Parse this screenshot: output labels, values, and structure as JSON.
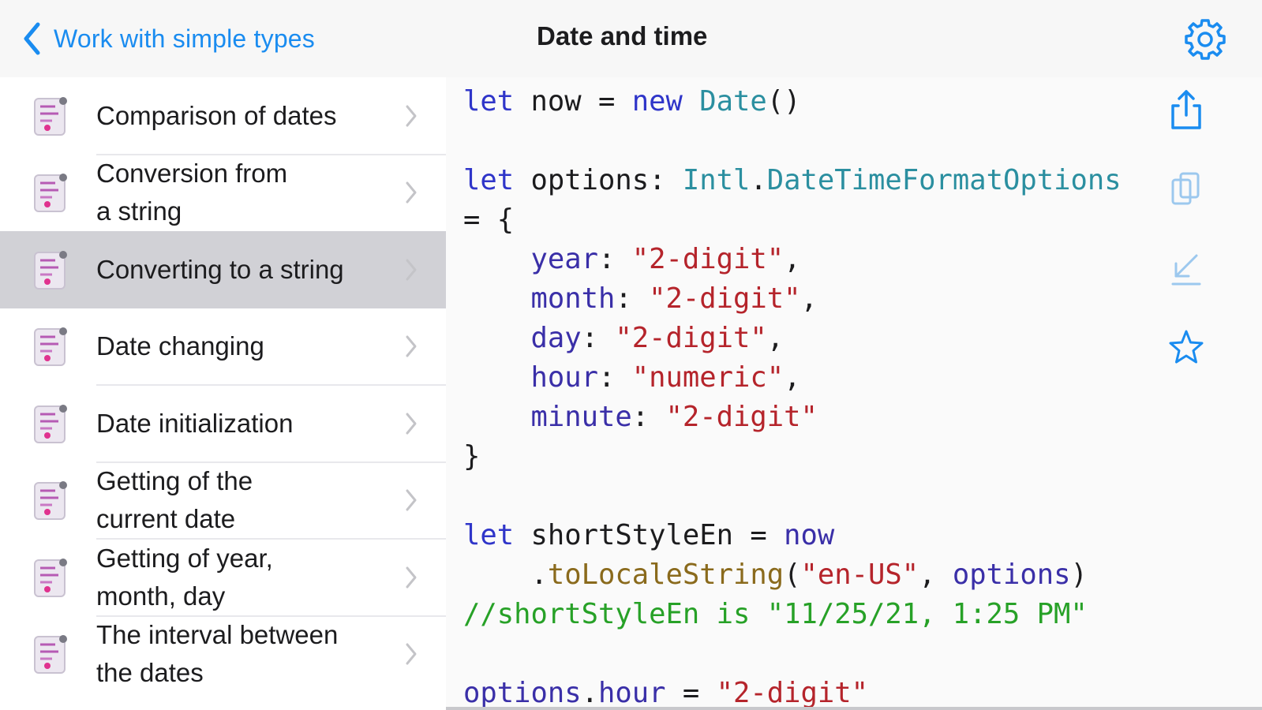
{
  "navbar": {
    "back_label": "Work with simple types",
    "title": "Date and time"
  },
  "sidebar": {
    "items": [
      {
        "label": "Comparison of dates",
        "selected": false
      },
      {
        "label": "Conversion from\na string",
        "selected": false
      },
      {
        "label": "Converting to a string",
        "selected": true
      },
      {
        "label": "Date changing",
        "selected": false
      },
      {
        "label": "Date initialization",
        "selected": false
      },
      {
        "label": "Getting of the\ncurrent date",
        "selected": false
      },
      {
        "label": "Getting of year,\nmonth, day",
        "selected": false
      },
      {
        "label": "The interval between\nthe dates",
        "selected": false
      }
    ]
  },
  "code_lines": [
    "let now = new Date()",
    "",
    "let options: Intl.DateTimeFormatOptions",
    "= {",
    "    year: \"2-digit\",",
    "    month: \"2-digit\",",
    "    day: \"2-digit\",",
    "    hour: \"numeric\",",
    "    minute: \"2-digit\"",
    "}",
    "",
    "let shortStyleEn = now",
    "    .toLocaleString(\"en-US\", options)",
    "//shortStyleEn is \"11/25/21, 1:25 PM\"",
    "",
    "options.hour = \"2-digit\""
  ],
  "icons": {
    "back": "chevron-left-icon",
    "settings": "gear-icon",
    "share": "share-icon",
    "copy": "copy-icon",
    "download": "download-icon",
    "favorite": "star-icon",
    "row_chevron": "chevron-right-icon",
    "row_icon": "code-file-icon"
  },
  "colors": {
    "accent": "#1a8cf0",
    "keyword": "#2f35c9",
    "type": "#2b8fa0",
    "string": "#b5242b",
    "comment": "#27a127",
    "selected_row": "#d1d1d6"
  }
}
